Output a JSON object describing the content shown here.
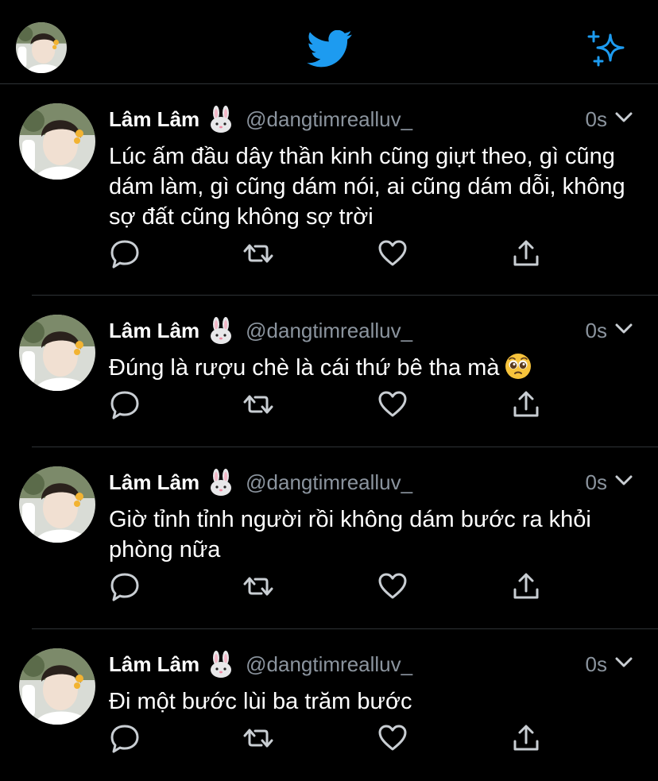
{
  "header": {
    "logo": "twitter-bird-icon",
    "right_icon": "sparkle-icon",
    "colors": {
      "accent": "#1d9bf0",
      "background": "#000000",
      "muted": "#8b949e"
    }
  },
  "tweets": [
    {
      "name": "Lâm Lâm",
      "handle": "@dangtimrealluv_",
      "time": "0s",
      "text": "Lúc ấm đầu dây thần kinh cũng giựt theo, gì cũng dám làm, gì cũng dám nói, ai cũng dám dỗi, không sợ đất cũng không sợ trời"
    },
    {
      "name": "Lâm Lâm",
      "handle": "@dangtimrealluv_",
      "time": "0s",
      "text": "Đúng là rượu chè là cái thứ bê tha mà",
      "emoji": "pleading-face"
    },
    {
      "name": "Lâm Lâm",
      "handle": "@dangtimrealluv_",
      "time": "0s",
      "text": "Giờ tỉnh tỉnh người rồi không dám bước ra khỏi phòng nữa"
    },
    {
      "name": "Lâm Lâm",
      "handle": "@dangtimrealluv_",
      "time": "0s",
      "text": "Đi một bước lùi ba trăm bước"
    }
  ]
}
